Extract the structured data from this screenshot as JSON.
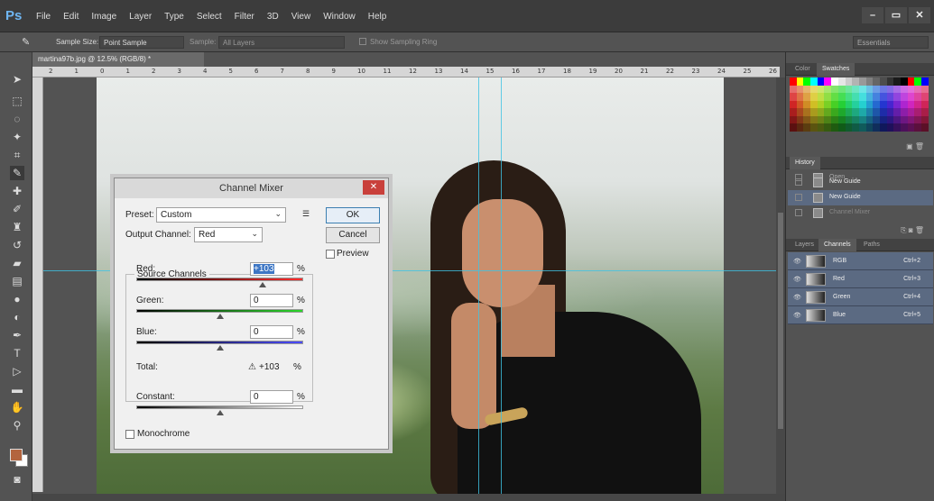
{
  "app": {
    "logo": "Ps",
    "menu": [
      "File",
      "Edit",
      "Image",
      "Layer",
      "Type",
      "Select",
      "Filter",
      "3D",
      "View",
      "Window",
      "Help"
    ],
    "window_controls": [
      "–",
      "▭",
      "✕"
    ]
  },
  "options": {
    "sample_size_label": "Sample Size:",
    "sample_size_value": "Point Sample",
    "sample_label": "Sample:",
    "sample_value": "All Layers",
    "show_ring_label": "Show Sampling Ring",
    "workspace": "Essentials"
  },
  "document": {
    "tab_title": "martina97b.jpg @ 12.5% (RGB/8) *",
    "ruler_ticks": [
      "2",
      "1",
      "0",
      "1",
      "2",
      "3",
      "4",
      "5",
      "6",
      "7",
      "8",
      "9",
      "10",
      "11",
      "12",
      "13",
      "14",
      "15",
      "16",
      "17",
      "18",
      "19",
      "20",
      "21",
      "22",
      "23",
      "24",
      "25",
      "26"
    ]
  },
  "dialog": {
    "title": "Channel Mixer",
    "preset_label": "Preset:",
    "preset_value": "Custom",
    "output_label": "Output Channel:",
    "output_value": "Red",
    "ok": "OK",
    "cancel": "Cancel",
    "preview_label": "Preview",
    "source_title": "Source Channels",
    "red_label": "Red:",
    "red_value": "+103",
    "green_label": "Green:",
    "green_value": "0",
    "blue_label": "Blue:",
    "blue_value": "0",
    "percent": "%",
    "total_label": "Total:",
    "total_value": "+103",
    "constant_label": "Constant:",
    "constant_value": "0",
    "monochrome_label": "Monochrome",
    "red_level_pct": 103,
    "green_level_pct": 0,
    "blue_level_pct": 0,
    "constant_level_pct": 0
  },
  "panels": {
    "color_tab": "Color",
    "swatches_tab": "Swatches",
    "history_tab": "History",
    "history_items": [
      "Open",
      "New Guide",
      "New Guide",
      "Channel Mixer"
    ],
    "layers_tab": "Layers",
    "channels_tab": "Channels",
    "paths_tab": "Paths",
    "channels": [
      {
        "name": "RGB",
        "shortcut": "Ctrl+2"
      },
      {
        "name": "Red",
        "shortcut": "Ctrl+3"
      },
      {
        "name": "Green",
        "shortcut": "Ctrl+4"
      },
      {
        "name": "Blue",
        "shortcut": "Ctrl+5"
      }
    ]
  }
}
